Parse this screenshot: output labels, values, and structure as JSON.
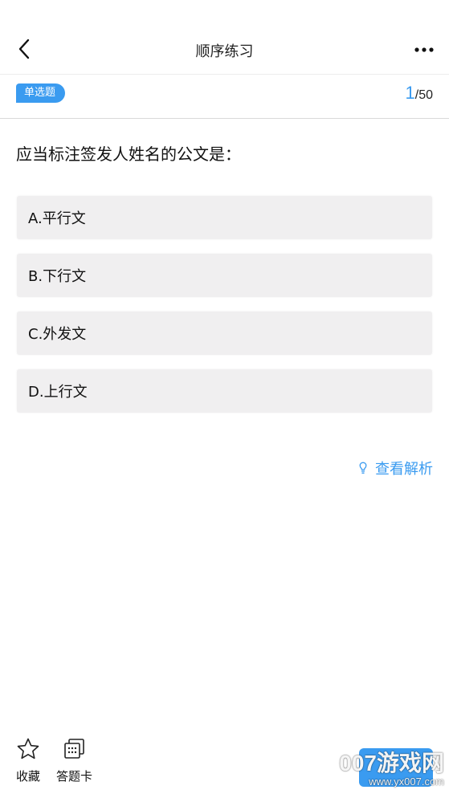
{
  "header": {
    "title": "顺序练习",
    "back_icon": "chevron-left-icon",
    "more_icon": "more-horizontal-icon"
  },
  "subbar": {
    "question_type": "单选题",
    "current": "1",
    "separator": "/",
    "total": "50"
  },
  "question": {
    "text": "应当标注签发人姓名的公文是："
  },
  "options": [
    {
      "label": "A.平行文"
    },
    {
      "label": "B.下行文"
    },
    {
      "label": "C.外发文"
    },
    {
      "label": "D.上行文"
    }
  ],
  "analysis": {
    "label": "查看解析",
    "icon": "lightbulb-icon"
  },
  "bottom_bar": {
    "favorite_label": "收藏",
    "favorite_icon": "star-icon",
    "answer_card_label": "答题卡",
    "answer_card_icon": "answer-card-icon",
    "watermark_main": "007游戏网",
    "watermark_url": "www.yx007.com"
  },
  "colors": {
    "accent": "#3a9bf0",
    "option_bg": "#f0eff0",
    "divider": "#d9d9d9"
  }
}
